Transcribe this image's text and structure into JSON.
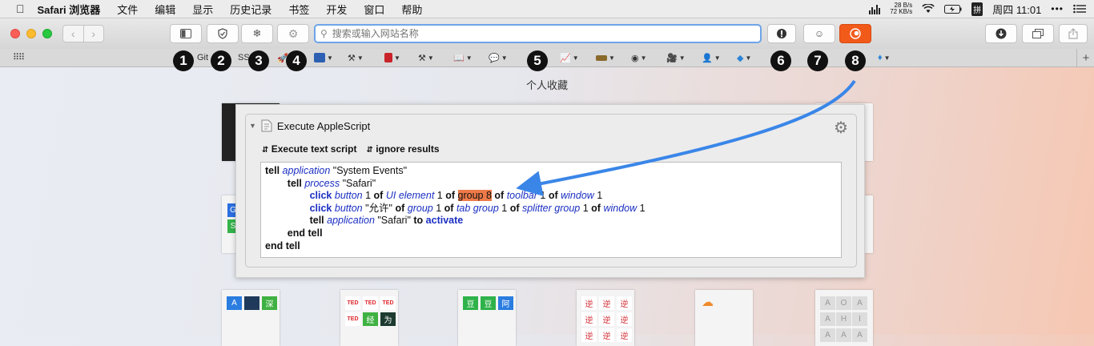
{
  "menubar": {
    "app_name": "Safari 浏览器",
    "items": [
      "文件",
      "编辑",
      "显示",
      "历史记录",
      "书签",
      "开发",
      "窗口",
      "帮助"
    ],
    "net_up": "28 B/s",
    "net_down": "72 KB/s",
    "ime": "拼",
    "clock": "周四 11:01"
  },
  "toolbar": {
    "search_placeholder": "搜索或输入网站名称"
  },
  "bookmarks": {
    "items": [
      {
        "label": "Git",
        "has_menu": false
      },
      {
        "label": "SS",
        "has_menu": false
      }
    ],
    "markers": [
      "1",
      "2",
      "3",
      "4",
      "5",
      "6",
      "7",
      "8"
    ]
  },
  "favorites": {
    "title": "个人收藏",
    "tile1_squares": [
      "A",
      "深"
    ],
    "tile2_squares": [
      "TED",
      "TED",
      "TED",
      "TED",
      "经",
      "为"
    ],
    "tile3_squares": [
      "豆",
      "豆",
      "阿"
    ],
    "tile4_glyph": "逆",
    "tile6_letters": [
      "A",
      "O",
      "A",
      "A",
      "H",
      "I",
      "A",
      "A",
      "A"
    ],
    "side_letters": [
      "G",
      "S"
    ]
  },
  "applescript": {
    "title": "Execute AppleScript",
    "option1": "Execute text script",
    "option2": "ignore results",
    "code": [
      [
        {
          "t": "tell",
          "s": "k"
        },
        {
          "t": " "
        },
        {
          "t": "application",
          "s": "c"
        },
        {
          "t": " \"System Events\""
        }
      ],
      [
        {
          "t": "        "
        },
        {
          "t": "tell",
          "s": "k"
        },
        {
          "t": " "
        },
        {
          "t": "process",
          "s": "c"
        },
        {
          "t": " \"Safari\""
        }
      ],
      [
        {
          "t": "                "
        },
        {
          "t": "click",
          "s": "v"
        },
        {
          "t": " "
        },
        {
          "t": "button",
          "s": "c"
        },
        {
          "t": " 1 "
        },
        {
          "t": "of",
          "s": "k"
        },
        {
          "t": " "
        },
        {
          "t": "UI element",
          "s": "c"
        },
        {
          "t": " 1 "
        },
        {
          "t": "of",
          "s": "k"
        },
        {
          "t": " "
        },
        {
          "t": "group 8",
          "s": "hl"
        },
        {
          "t": " "
        },
        {
          "t": "of",
          "s": "k"
        },
        {
          "t": " "
        },
        {
          "t": "toolbar",
          "s": "c"
        },
        {
          "t": " 1 "
        },
        {
          "t": "of",
          "s": "k"
        },
        {
          "t": " "
        },
        {
          "t": "window",
          "s": "c"
        },
        {
          "t": " 1"
        }
      ],
      [
        {
          "t": "                "
        },
        {
          "t": "click",
          "s": "v"
        },
        {
          "t": " "
        },
        {
          "t": "button",
          "s": "c"
        },
        {
          "t": " \"允许\" "
        },
        {
          "t": "of",
          "s": "k"
        },
        {
          "t": " "
        },
        {
          "t": "group",
          "s": "c"
        },
        {
          "t": " 1 "
        },
        {
          "t": "of",
          "s": "k"
        },
        {
          "t": " "
        },
        {
          "t": "tab group",
          "s": "c"
        },
        {
          "t": " 1 "
        },
        {
          "t": "of",
          "s": "k"
        },
        {
          "t": " "
        },
        {
          "t": "splitter group",
          "s": "c"
        },
        {
          "t": " 1 "
        },
        {
          "t": "of",
          "s": "k"
        },
        {
          "t": " "
        },
        {
          "t": "window",
          "s": "c"
        },
        {
          "t": " 1"
        }
      ],
      [
        {
          "t": "                "
        },
        {
          "t": "tell",
          "s": "k"
        },
        {
          "t": " "
        },
        {
          "t": "application",
          "s": "c"
        },
        {
          "t": " \"Safari\" "
        },
        {
          "t": "to",
          "s": "k"
        },
        {
          "t": " "
        },
        {
          "t": "activate",
          "s": "v"
        }
      ],
      [
        {
          "t": "        "
        },
        {
          "t": "end tell",
          "s": "k"
        }
      ],
      [
        {
          "t": "end tell",
          "s": "k"
        }
      ]
    ]
  },
  "colors": {
    "accent_blue": "#3a86e8",
    "highlight_orange": "#ee7a48",
    "keyword_blue": "#1b2fc2"
  }
}
